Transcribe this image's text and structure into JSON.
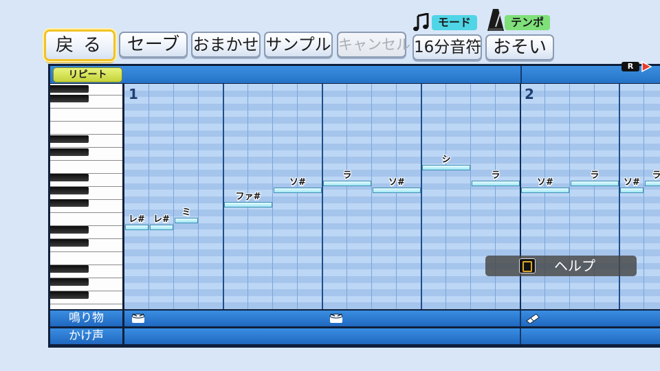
{
  "toolbar": {
    "back": "戻る",
    "save": "セーブ",
    "omakase": "おまかせ",
    "sample": "サンプル",
    "cancel": "キャンセル",
    "note_length": "16分音符",
    "tempo_value": "おそい",
    "mode_label": "モード",
    "tempo_label": "テンポ"
  },
  "editor": {
    "repeat_label": "リピート",
    "badge_r": "R",
    "measures": [
      "1",
      "2"
    ]
  },
  "notes": [
    {
      "label": "レ#",
      "step": 0,
      "length": 1
    },
    {
      "label": "レ#",
      "step": 1,
      "length": 1
    },
    {
      "label": "ミ",
      "step": 2,
      "length": 1
    },
    {
      "label": "ファ#",
      "step": 4,
      "length": 2
    },
    {
      "label": "ソ#",
      "step": 6,
      "length": 2
    },
    {
      "label": "ラ",
      "step": 8,
      "length": 2
    },
    {
      "label": "ソ#",
      "step": 10,
      "length": 2
    },
    {
      "label": "シ",
      "step": 12,
      "length": 2
    },
    {
      "label": "ラ",
      "step": 14,
      "length": 2
    },
    {
      "label": "ソ#",
      "step": 16,
      "length": 2
    },
    {
      "label": "ラ",
      "step": 18,
      "length": 2
    },
    {
      "label": "ソ#",
      "step": 20,
      "length": 1
    },
    {
      "label": "ラ",
      "step": 21,
      "length": 1
    }
  ],
  "tracks": {
    "instrument_label": "鳴り物",
    "voice_label": "かけ声"
  },
  "help": {
    "label": "ヘルプ"
  },
  "colors": {
    "accent_yellow": "#f3c227",
    "grid_blue": "#a9c8ef",
    "note_cyan": "#9ee6f4",
    "track_blue": "#2472c8"
  }
}
